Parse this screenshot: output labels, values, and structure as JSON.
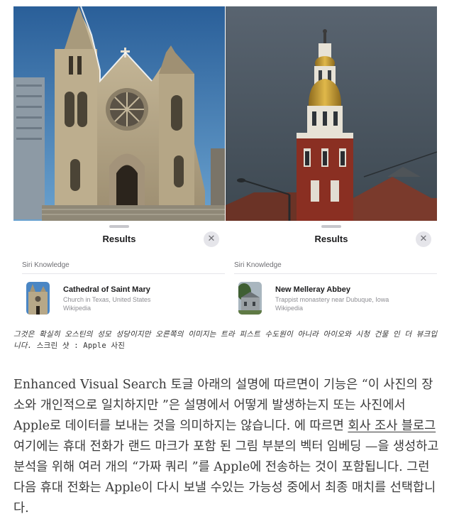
{
  "panels": [
    {
      "sheet_title": "Results",
      "section_label": "Siri Knowledge",
      "result": {
        "title": "Cathedral of Saint Mary",
        "subtitle": "Church in Texas, United States",
        "source": "Wikipedia"
      }
    },
    {
      "sheet_title": "Results",
      "section_label": "Siri Knowledge",
      "result": {
        "title": "New Melleray Abbey",
        "subtitle": "Trappist monastery near Dubuque, Iowa",
        "source": "Wikipedia"
      }
    }
  ],
  "icons": {
    "close": "close-icon",
    "close_glyph": "✕"
  },
  "caption": {
    "italic_part": "그것은 확실히 오스틴의 성모 성당이지만 오른쪽의 이미지는 트라 피스트 수도원이 아니라 아이오와 시청 건물 인 더 뷰크입니다.",
    "credit": " 스크린 샷 : Apple 사진"
  },
  "article": {
    "part1": "Enhanced Visual Search 토글 아래의 설명에 따르면이 기능은 “이 사진의 장소와 개인적으로 일치하지만 ”은 설명에서 어떻게 발생하는지 또는 사진에서 Apple로 데이터를 보내는 것을 의미하지는 않습니다. 에 따르면 ",
    "link_text": "회사 조사 블로그",
    "part2": "여기에는 휴대 전화가 랜드 마크가 포함 된 그림 부분의 벡터 임베딩 —을 생성하고 분석을 위해 여러 개의 “가짜 쿼리 ”를 Apple에 전송하는 것이 포함됩니다. 그런 다음 휴대 전화는 Apple이 다시 보낼 수있는 가능성 중에서 최종 매치를 선택합니다."
  },
  "colors": {
    "sky_left": "#2f6fa8",
    "sky_right": "#4d5963",
    "stone": "#b8a98c",
    "brick": "#8a2f22",
    "gold": "#c9a032"
  }
}
